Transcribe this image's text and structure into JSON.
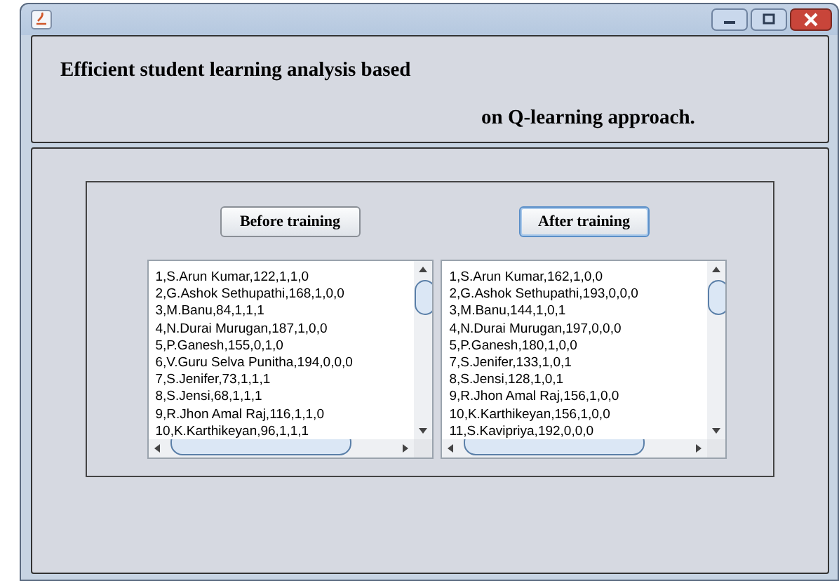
{
  "heading": {
    "line_1": "Efficient student learning analysis based",
    "line_2": "on Q-learning approach."
  },
  "panels": [
    {
      "button": {
        "label": "Before training",
        "focused": false
      },
      "list": [
        "1,S.Arun Kumar,122,1,1,0",
        "2,G.Ashok Sethupathi,168,1,0,0",
        "3,M.Banu,84,1,1,1",
        "4,N.Durai Murugan,187,1,0,0",
        "5,P.Ganesh,155,0,1,0",
        "6,V.Guru Selva Punitha,194,0,0,0",
        "7,S.Jenifer,73,1,1,1",
        "8,S.Jensi,68,1,1,1",
        "9,R.Jhon Amal Raj,116,1,1,0",
        "10,K.Karthikeyan,96,1,1,1"
      ]
    },
    {
      "button": {
        "label": "After training",
        "focused": true
      },
      "list": [
        "1,S.Arun Kumar,162,1,0,0",
        "2,G.Ashok Sethupathi,193,0,0,0",
        "3,M.Banu,144,1,0,1",
        "4,N.Durai Murugan,197,0,0,0",
        "5,P.Ganesh,180,1,0,0",
        "7,S.Jenifer,133,1,0,1",
        "8,S.Jensi,128,1,0,1",
        "9,R.Jhon Amal Raj,156,1,0,0",
        "10,K.Karthikeyan,156,1,0,0",
        "11,S.Kavipriya,192,0,0,0"
      ]
    }
  ]
}
